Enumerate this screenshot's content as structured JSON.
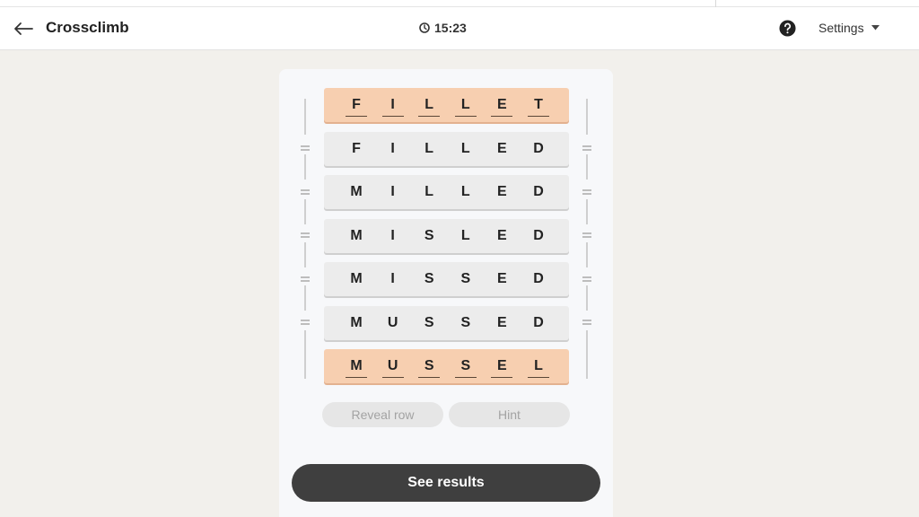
{
  "header": {
    "title": "Crossclimb",
    "timer": "15:23",
    "settings_label": "Settings"
  },
  "icons": {
    "back": "arrow-left-icon",
    "timer": "clock-icon",
    "help": "question-circle-icon",
    "settings_caret": "caret-down-icon"
  },
  "board": {
    "rows": [
      {
        "letters": [
          "F",
          "I",
          "L",
          "L",
          "E",
          "T"
        ],
        "locked": true
      },
      {
        "letters": [
          "F",
          "I",
          "L",
          "L",
          "E",
          "D"
        ],
        "locked": false
      },
      {
        "letters": [
          "M",
          "I",
          "L",
          "L",
          "E",
          "D"
        ],
        "locked": false
      },
      {
        "letters": [
          "M",
          "I",
          "S",
          "L",
          "E",
          "D"
        ],
        "locked": false
      },
      {
        "letters": [
          "M",
          "I",
          "S",
          "S",
          "E",
          "D"
        ],
        "locked": false
      },
      {
        "letters": [
          "M",
          "U",
          "S",
          "S",
          "E",
          "D"
        ],
        "locked": false
      },
      {
        "letters": [
          "M",
          "U",
          "S",
          "S",
          "E",
          "L"
        ],
        "locked": true
      }
    ]
  },
  "actions": {
    "reveal_row": "Reveal row",
    "hint": "Hint",
    "see_results": "See results"
  },
  "colors": {
    "locked_row": "#f7cfb0",
    "plain_row": "#ececec",
    "primary_button": "#3f3f3f",
    "background": "#f2f0ec"
  }
}
